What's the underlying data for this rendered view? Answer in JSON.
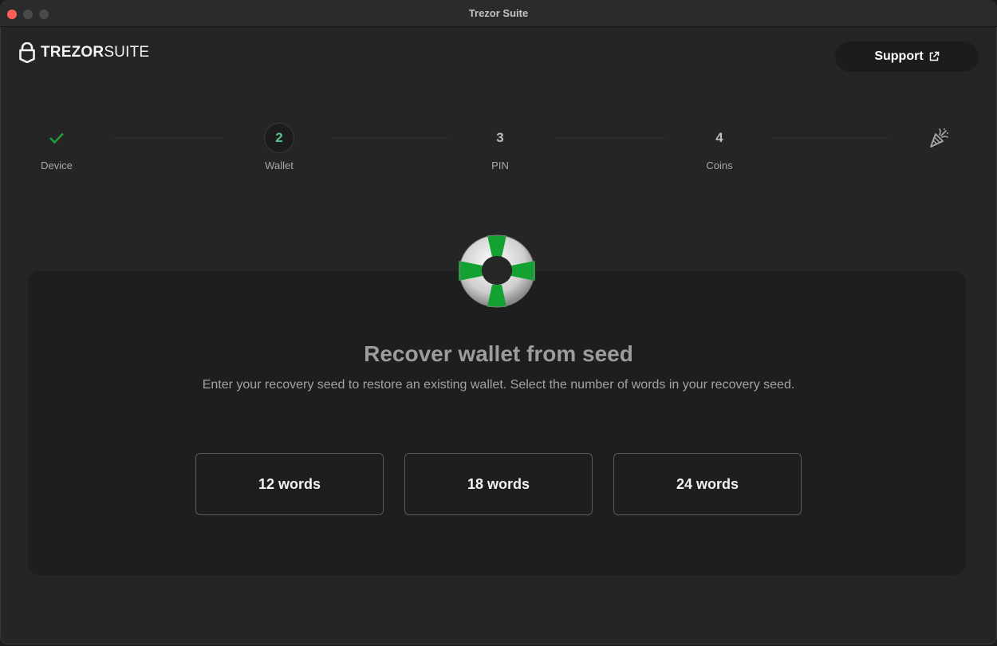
{
  "window": {
    "title": "Trezor Suite"
  },
  "header": {
    "logo_bold": "TREZOR",
    "logo_light": "SUITE",
    "support_label": "Support"
  },
  "stepper": {
    "steps": [
      {
        "label": "Device",
        "mark": "",
        "state": "done"
      },
      {
        "label": "Wallet",
        "mark": "2",
        "state": "active"
      },
      {
        "label": "PIN",
        "mark": "3",
        "state": "upcoming"
      },
      {
        "label": "Coins",
        "mark": "4",
        "state": "upcoming"
      }
    ],
    "final_icon": "party-popper-icon"
  },
  "recovery": {
    "icon": "lifebuoy-icon",
    "title": "Recover wallet from seed",
    "description": "Enter your recovery seed to restore an existing wallet. Select the number of words in your recovery seed.",
    "options": [
      "12 words",
      "18 words",
      "24 words"
    ]
  },
  "colors": {
    "accent_green": "#57c48f",
    "check_green": "#1f9d3a",
    "close_red": "#fe5f57"
  }
}
